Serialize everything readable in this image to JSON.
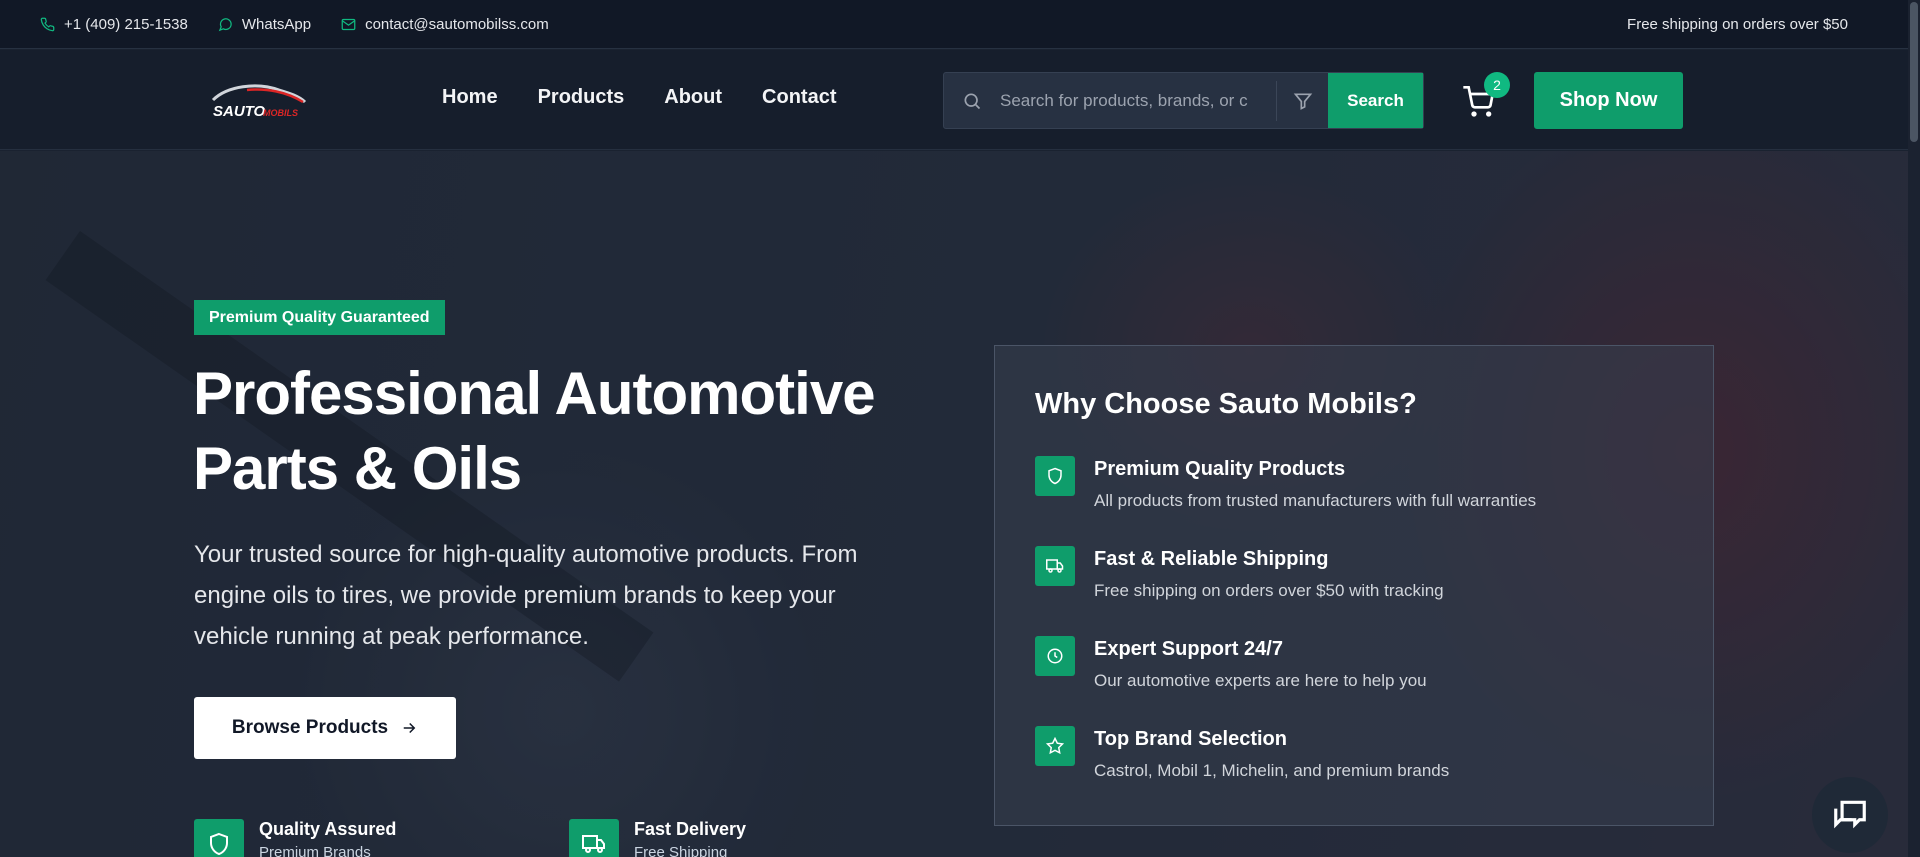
{
  "topbar": {
    "phone": "+1 (409) 215-1538",
    "whatsapp": "WhatsApp",
    "email": "contact@sautomobilss.com",
    "shipping": "Free shipping on orders over $50"
  },
  "header": {
    "logo_text": "SAUTO MOBILS",
    "nav": [
      "Home",
      "Products",
      "About",
      "Contact"
    ],
    "search_placeholder": "Search for products, brands, or c",
    "search_button": "Search",
    "cart_count": "2",
    "shop_now": "Shop Now"
  },
  "hero": {
    "badge": "Premium Quality Guaranteed",
    "title_line1": "Professional Automotive",
    "title_line2": "Parts & Oils",
    "description": "Your trusted source for high-quality automotive products. From engine oils to tires, we provide premium brands to keep your vehicle running at peak performance.",
    "browse_button": "Browse Products",
    "features": [
      {
        "title": "Quality Assured",
        "subtitle": "Premium Brands",
        "icon": "shield-icon"
      },
      {
        "title": "Fast Delivery",
        "subtitle": "Free Shipping",
        "icon": "truck-icon"
      }
    ]
  },
  "why": {
    "title": "Why Choose Sauto Mobils?",
    "items": [
      {
        "title": "Premium Quality Products",
        "text": "All products from trusted manufacturers with full warranties",
        "icon": "shield-icon"
      },
      {
        "title": "Fast & Reliable Shipping",
        "text": "Free shipping on orders over $50 with tracking",
        "icon": "truck-icon"
      },
      {
        "title": "Expert Support 24/7",
        "text": "Our automotive experts are here to help you",
        "icon": "clock-icon"
      },
      {
        "title": "Top Brand Selection",
        "text": "Castrol, Mobil 1, Michelin, and premium brands",
        "icon": "star-icon"
      }
    ]
  },
  "colors": {
    "accent": "#0f9d6b",
    "topbar_bg": "#111826",
    "header_bg": "#161e2c"
  }
}
